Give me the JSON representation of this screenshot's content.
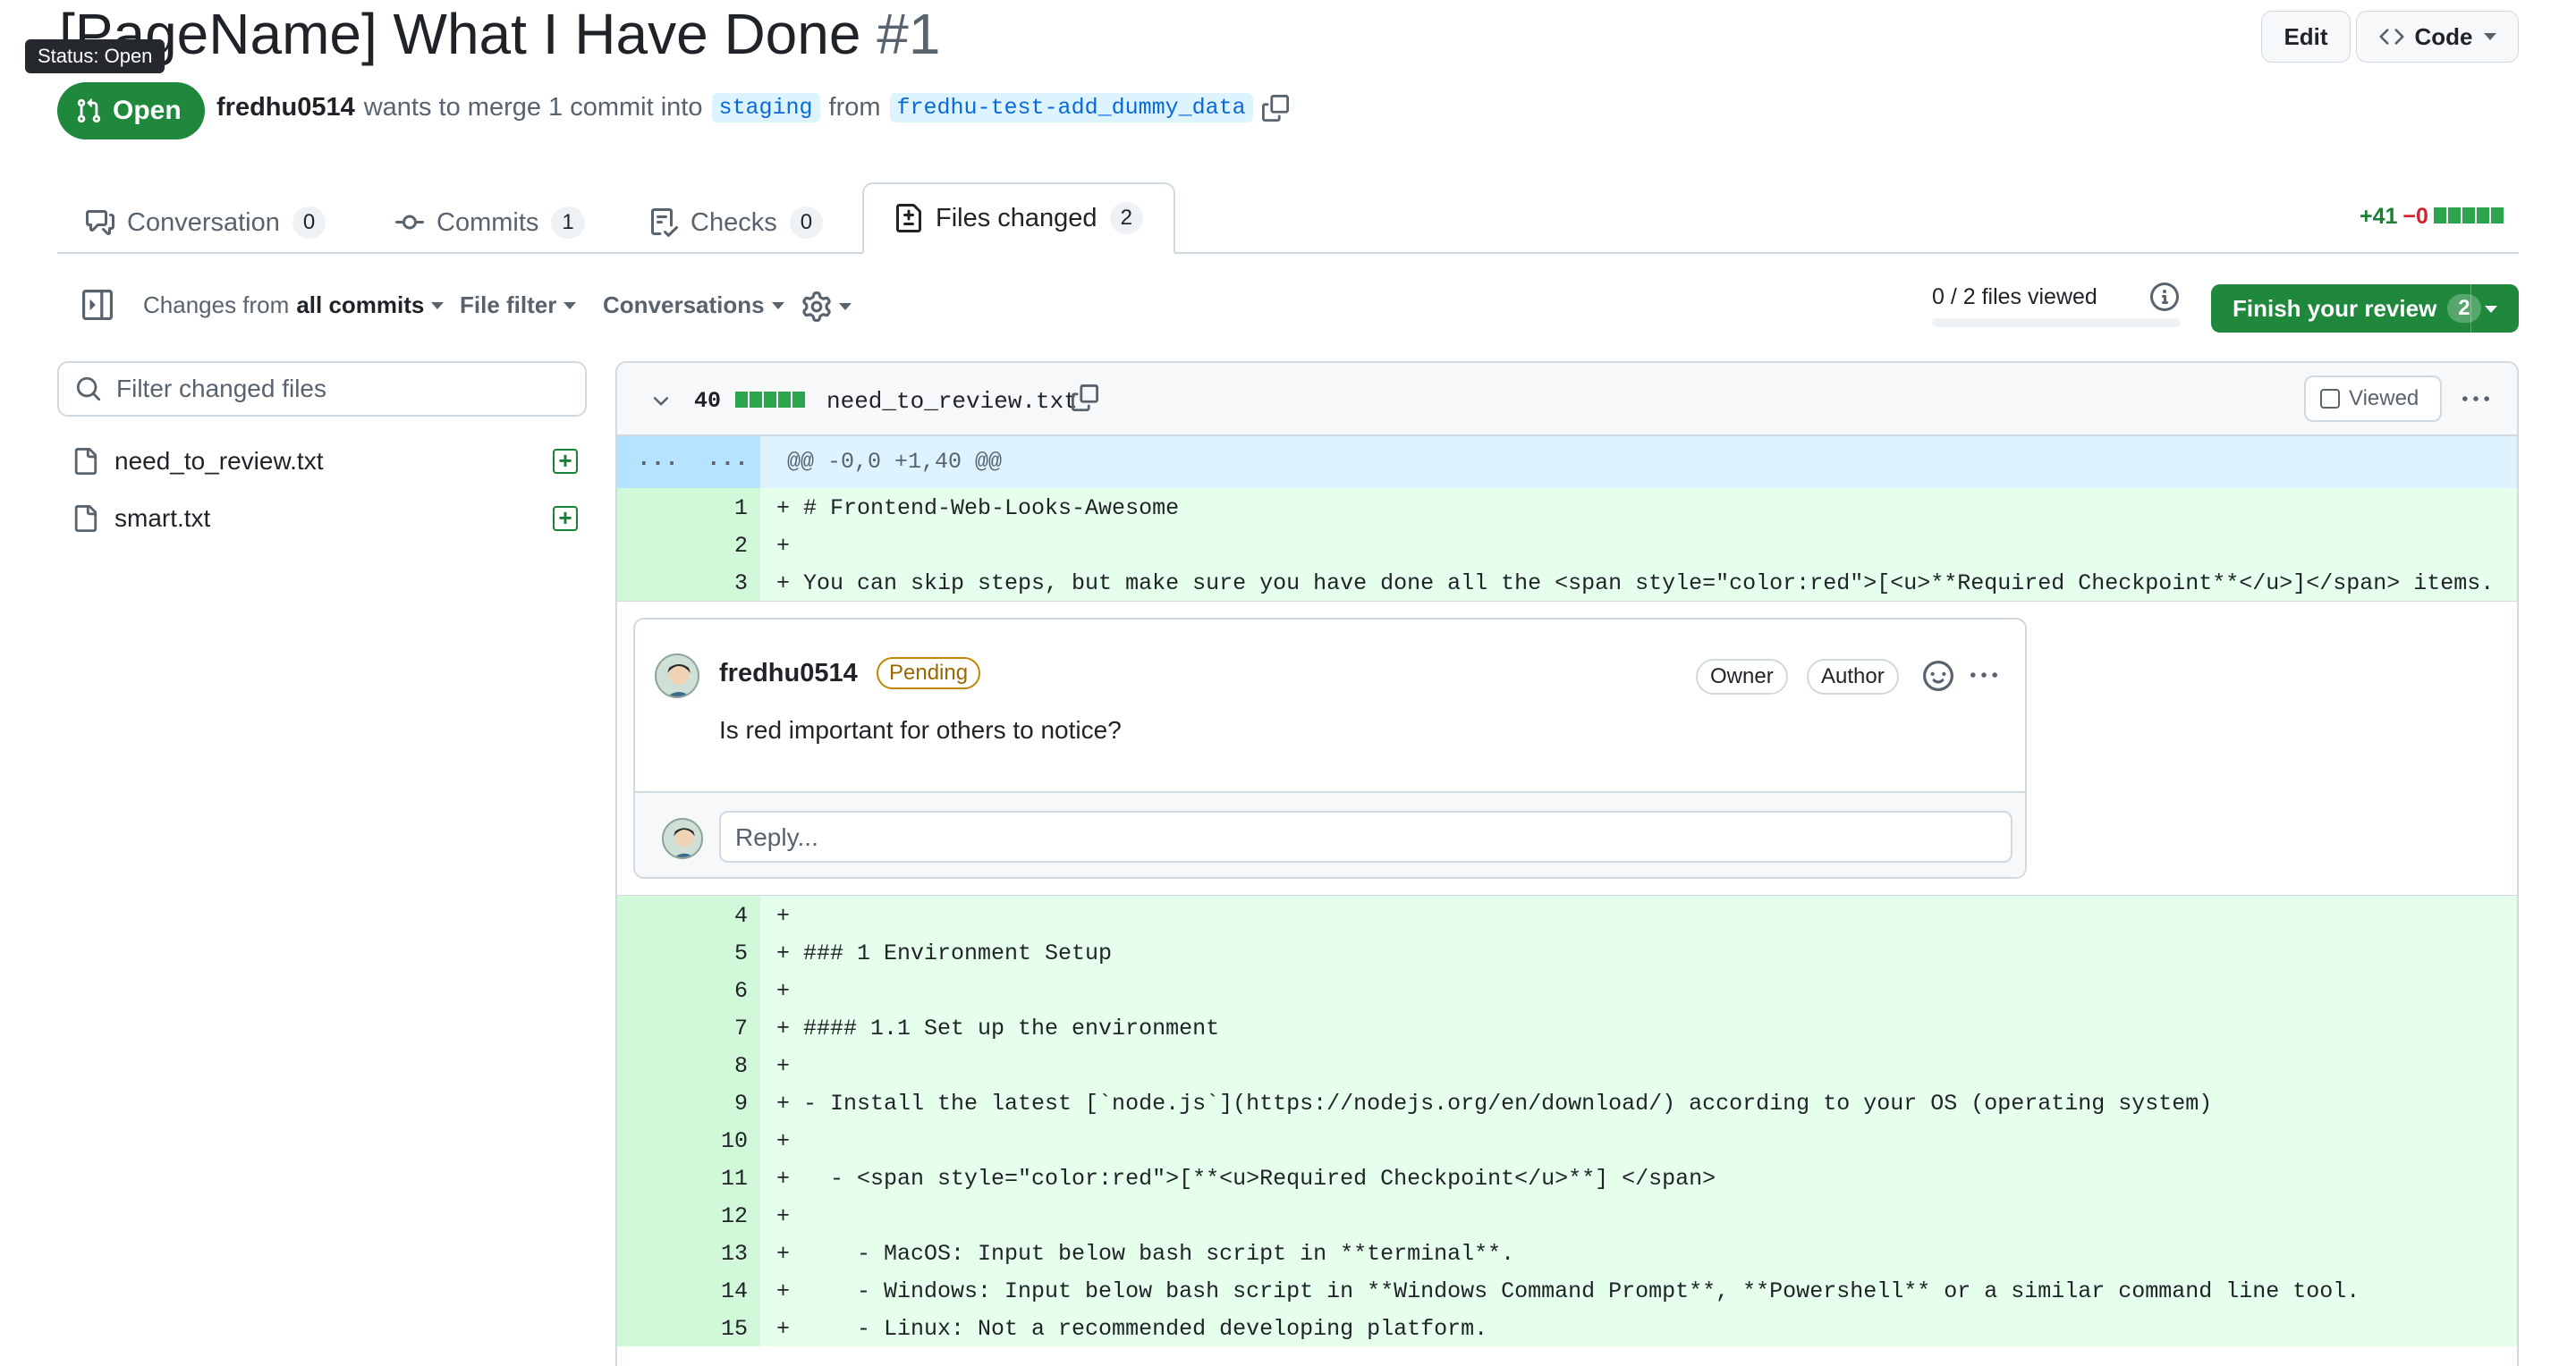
{
  "pr": {
    "title": "[PageName] What I Have Done",
    "number": "#1",
    "status_tooltip": "Status: Open",
    "state": "Open",
    "author": "fredhu0514",
    "merge_text": "wants to merge 1 commit into",
    "base_branch": "staging",
    "from_text": "from",
    "head_branch": "fredhu-test-add_dummy_data"
  },
  "header_buttons": {
    "edit": "Edit",
    "code": "Code"
  },
  "tabs": [
    {
      "label": "Conversation",
      "count": "0"
    },
    {
      "label": "Commits",
      "count": "1"
    },
    {
      "label": "Checks",
      "count": "0"
    },
    {
      "label": "Files changed",
      "count": "2"
    }
  ],
  "diffstat": {
    "additions": "+41",
    "deletions": "−0"
  },
  "toolbar": {
    "changes_prefix": "Changes from",
    "changes_value": "all commits",
    "file_filter": "File filter",
    "conversations": "Conversations",
    "files_viewed": "0 / 2 files viewed",
    "files_viewed_fraction": 0,
    "finish_review": "Finish your review",
    "finish_count": "2"
  },
  "sidebar": {
    "filter_placeholder": "Filter changed files",
    "files": [
      "need_to_review.txt",
      "smart.txt"
    ]
  },
  "file": {
    "changes": "40",
    "name": "need_to_review.txt",
    "viewed_label": "Viewed",
    "hunk_left": "...",
    "hunk_right": "...",
    "hunk_header": "@@ -0,0 +1,40 @@"
  },
  "lines_before": [
    {
      "n": "1",
      "text": "+ # Frontend-Web-Looks-Awesome"
    },
    {
      "n": "2",
      "text": "+"
    },
    {
      "n": "3",
      "text": "+ You can skip steps, but make sure you have done all the <span style=\"color:red\">[<u>**Required Checkpoint**</u>]</span> items."
    }
  ],
  "comment": {
    "author": "fredhu0514",
    "status": "Pending",
    "badges": [
      "Owner",
      "Author"
    ],
    "body": "Is red important for others to notice?",
    "reply_placeholder": "Reply..."
  },
  "lines_after": [
    {
      "n": "4",
      "text": "+"
    },
    {
      "n": "5",
      "text": "+ ### 1 Environment Setup"
    },
    {
      "n": "6",
      "text": "+"
    },
    {
      "n": "7",
      "text": "+ #### 1.1 Set up the environment"
    },
    {
      "n": "8",
      "text": "+"
    },
    {
      "n": "9",
      "text": "+ - Install the latest [`node.js`](https://nodejs.org/en/download/) according to your OS (operating system)"
    },
    {
      "n": "10",
      "text": "+"
    },
    {
      "n": "11",
      "text": "+   - <span style=\"color:red\">[**<u>Required Checkpoint</u>**] </span>"
    },
    {
      "n": "12",
      "text": "+"
    },
    {
      "n": "13",
      "text": "+     - MacOS: Input below bash script in **terminal**."
    },
    {
      "n": "14",
      "text": "+     - Windows: Input below bash script in **Windows Command Prompt**, **Powershell** or a similar command line tool."
    },
    {
      "n": "15",
      "text": "+     - Linux: Not a recommended developing platform."
    }
  ],
  "colors": {
    "open_green": "#1f883d",
    "added_line": "#e6ffec",
    "added_gutter": "#d1f8d9",
    "hunk_bg": "#ddf4ff",
    "link_blue": "#0969da"
  }
}
